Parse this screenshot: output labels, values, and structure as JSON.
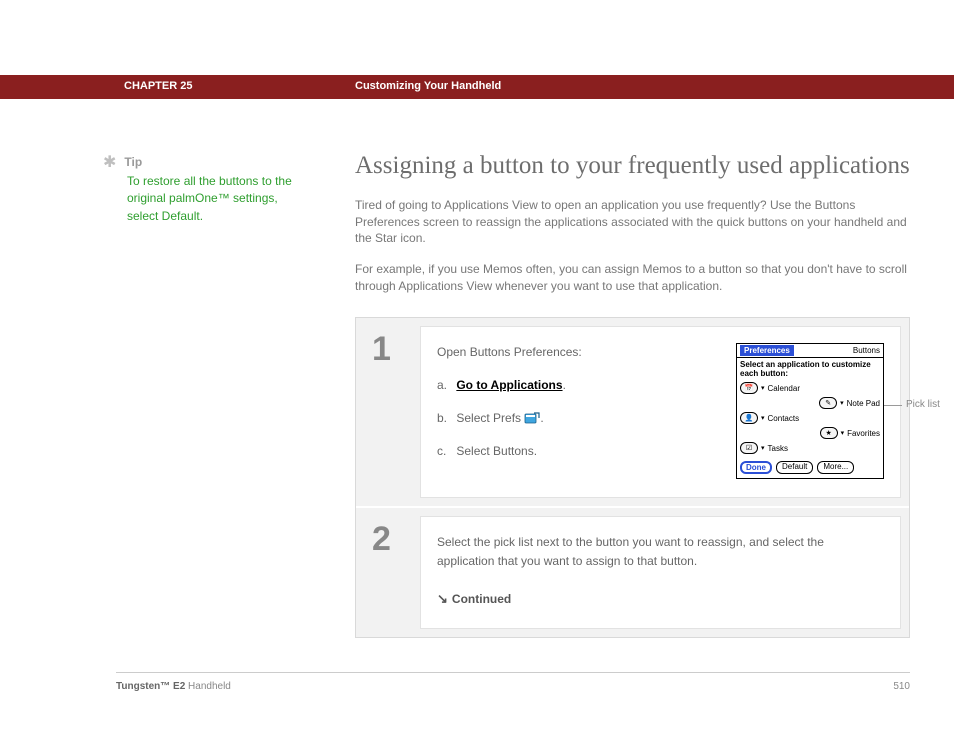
{
  "header": {
    "chapter": "CHAPTER 25",
    "title": "Customizing Your Handheld"
  },
  "tip": {
    "label": "Tip",
    "body": "To restore all the buttons to the original palmOne™ settings, select Default."
  },
  "main": {
    "title": "Assigning a button to your frequently used applications",
    "para1": "Tired of going to Applications View to open an application you use frequently? Use the Buttons Preferences screen to reassign the applications associated with the quick buttons on your handheld and the Star icon.",
    "para2": "For example, if you use Memos often, you can assign Memos to a button so that you don't have to scroll through Applications View whenever you want to use that application."
  },
  "steps": [
    {
      "num": "1",
      "lead": "Open Buttons Preferences:",
      "a_label": "a.",
      "a_link": "Go to Applications",
      "a_after": ".",
      "b_label": "b.",
      "b_text_before": "Select Prefs ",
      "b_text_after": ".",
      "c_label": "c.",
      "c_text": "Select Buttons."
    },
    {
      "num": "2",
      "text": "Select the pick list next to the button you want to reassign, and select the application that you want to assign to that button.",
      "continued": "Continued"
    }
  ],
  "screenshot": {
    "title": "Preferences",
    "corner": "Buttons",
    "subtitle": "Select an application to customize each button:",
    "rows": [
      {
        "icon": "cal",
        "label": "Calendar"
      },
      {
        "icon": "note",
        "label": "Note Pad",
        "right": true
      },
      {
        "icon": "contacts",
        "label": "Contacts"
      },
      {
        "icon": "star",
        "label": "Favorites",
        "right": true
      },
      {
        "icon": "tasks",
        "label": "Tasks"
      }
    ],
    "buttons": {
      "done": "Done",
      "default": "Default",
      "more": "More..."
    },
    "callout": "Pick list"
  },
  "footer": {
    "product_bold": "Tungsten™ E2",
    "product_rest": " Handheld",
    "page": "510"
  }
}
